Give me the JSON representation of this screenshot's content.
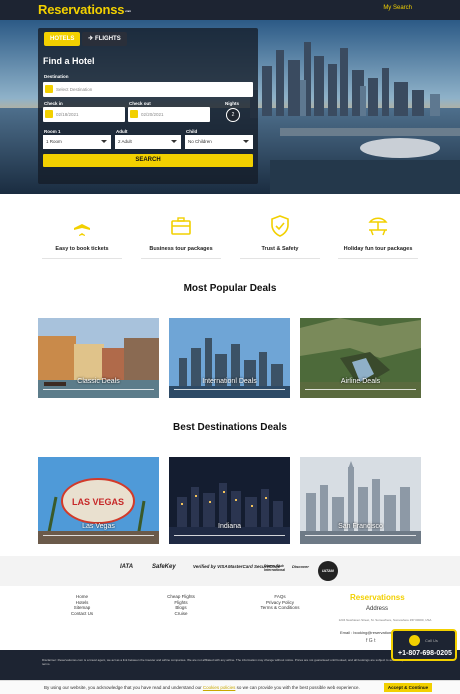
{
  "header": {
    "logo": "Reservationss",
    "logo_sub": "com",
    "my_search": "My Search"
  },
  "search_panel": {
    "tabs": [
      {
        "label": "HOTELS"
      },
      {
        "label": "FLIGHTS"
      }
    ],
    "title": "Find a Hotel",
    "destination_label": "Destination",
    "destination_placeholder": "Select Destination",
    "checkin_label": "Check in",
    "checkin_value": "02/18/2021",
    "checkout_label": "Check out",
    "checkout_value": "02/20/2021",
    "nights_label": "Nights",
    "nights_value": "2",
    "room_label": "Room 1",
    "room_value": "1 Room",
    "adult_label": "Adult",
    "adult_value": "2 Adult",
    "child_label": "Child",
    "child_value": "No Children",
    "search_label": "SEARCH"
  },
  "features": [
    {
      "label": "Easy to book tickets",
      "icon": "plane-icon"
    },
    {
      "label": "Business tour packages",
      "icon": "briefcase-icon"
    },
    {
      "label": "Trust & Safety",
      "icon": "shield-icon"
    },
    {
      "label": "Holiday fun tour packages",
      "icon": "beach-chair-icon"
    }
  ],
  "popular_title": "Most Popular Deals",
  "popular_deals": [
    {
      "label": "Classic Deals"
    },
    {
      "label": "Internationl Deals"
    },
    {
      "label": "Airline Deals"
    }
  ],
  "destinations_title": "Best Destinations Deals",
  "destinations": [
    {
      "label": "Las Vegas"
    },
    {
      "label": "Indiana"
    },
    {
      "label": "San Francisco"
    }
  ],
  "partner_logos": [
    "IATA",
    "SafeKey",
    "Verified by VISA",
    "MasterCard SecureCode",
    "Diners Club International",
    "Discover",
    "IATAN"
  ],
  "footer": {
    "col1": [
      "Home",
      "Hotels",
      "Sitemap",
      "Contact Us"
    ],
    "col2": [
      "Cheap Flights",
      "Flights",
      "Blogs",
      "Cruise"
    ],
    "col3": [
      "FAQs",
      "Privacy Policy",
      "Terms & Conditions"
    ],
    "brand": "Reservationss",
    "address_label": "Address",
    "address_text": "1234 Newhaven Street, St. Somewhere, Somewhere ZIP 00000, USA",
    "email": "Email : booking@reservationss.com"
  },
  "disclaimer": "Disclaimer: Reservationss.com is a travel agent, we act as a link between the traveler and airline companies. We are not affiliated with any airline. The information may change without notice. Prices are not guaranteed until booked, and all bookings are subject to availability and carrier terms.",
  "cookie": {
    "text": "By using our website, you acknowledge that you have read and understand our",
    "link": "Cookies policies",
    "text2": "so we can provide you with the best possible web experience.",
    "accept": "Accept & Continue"
  },
  "call": {
    "label": "Call Us",
    "number": "+1-807-698-0205"
  },
  "colors": {
    "accent": "#f2d000",
    "dark": "#1d2432"
  }
}
